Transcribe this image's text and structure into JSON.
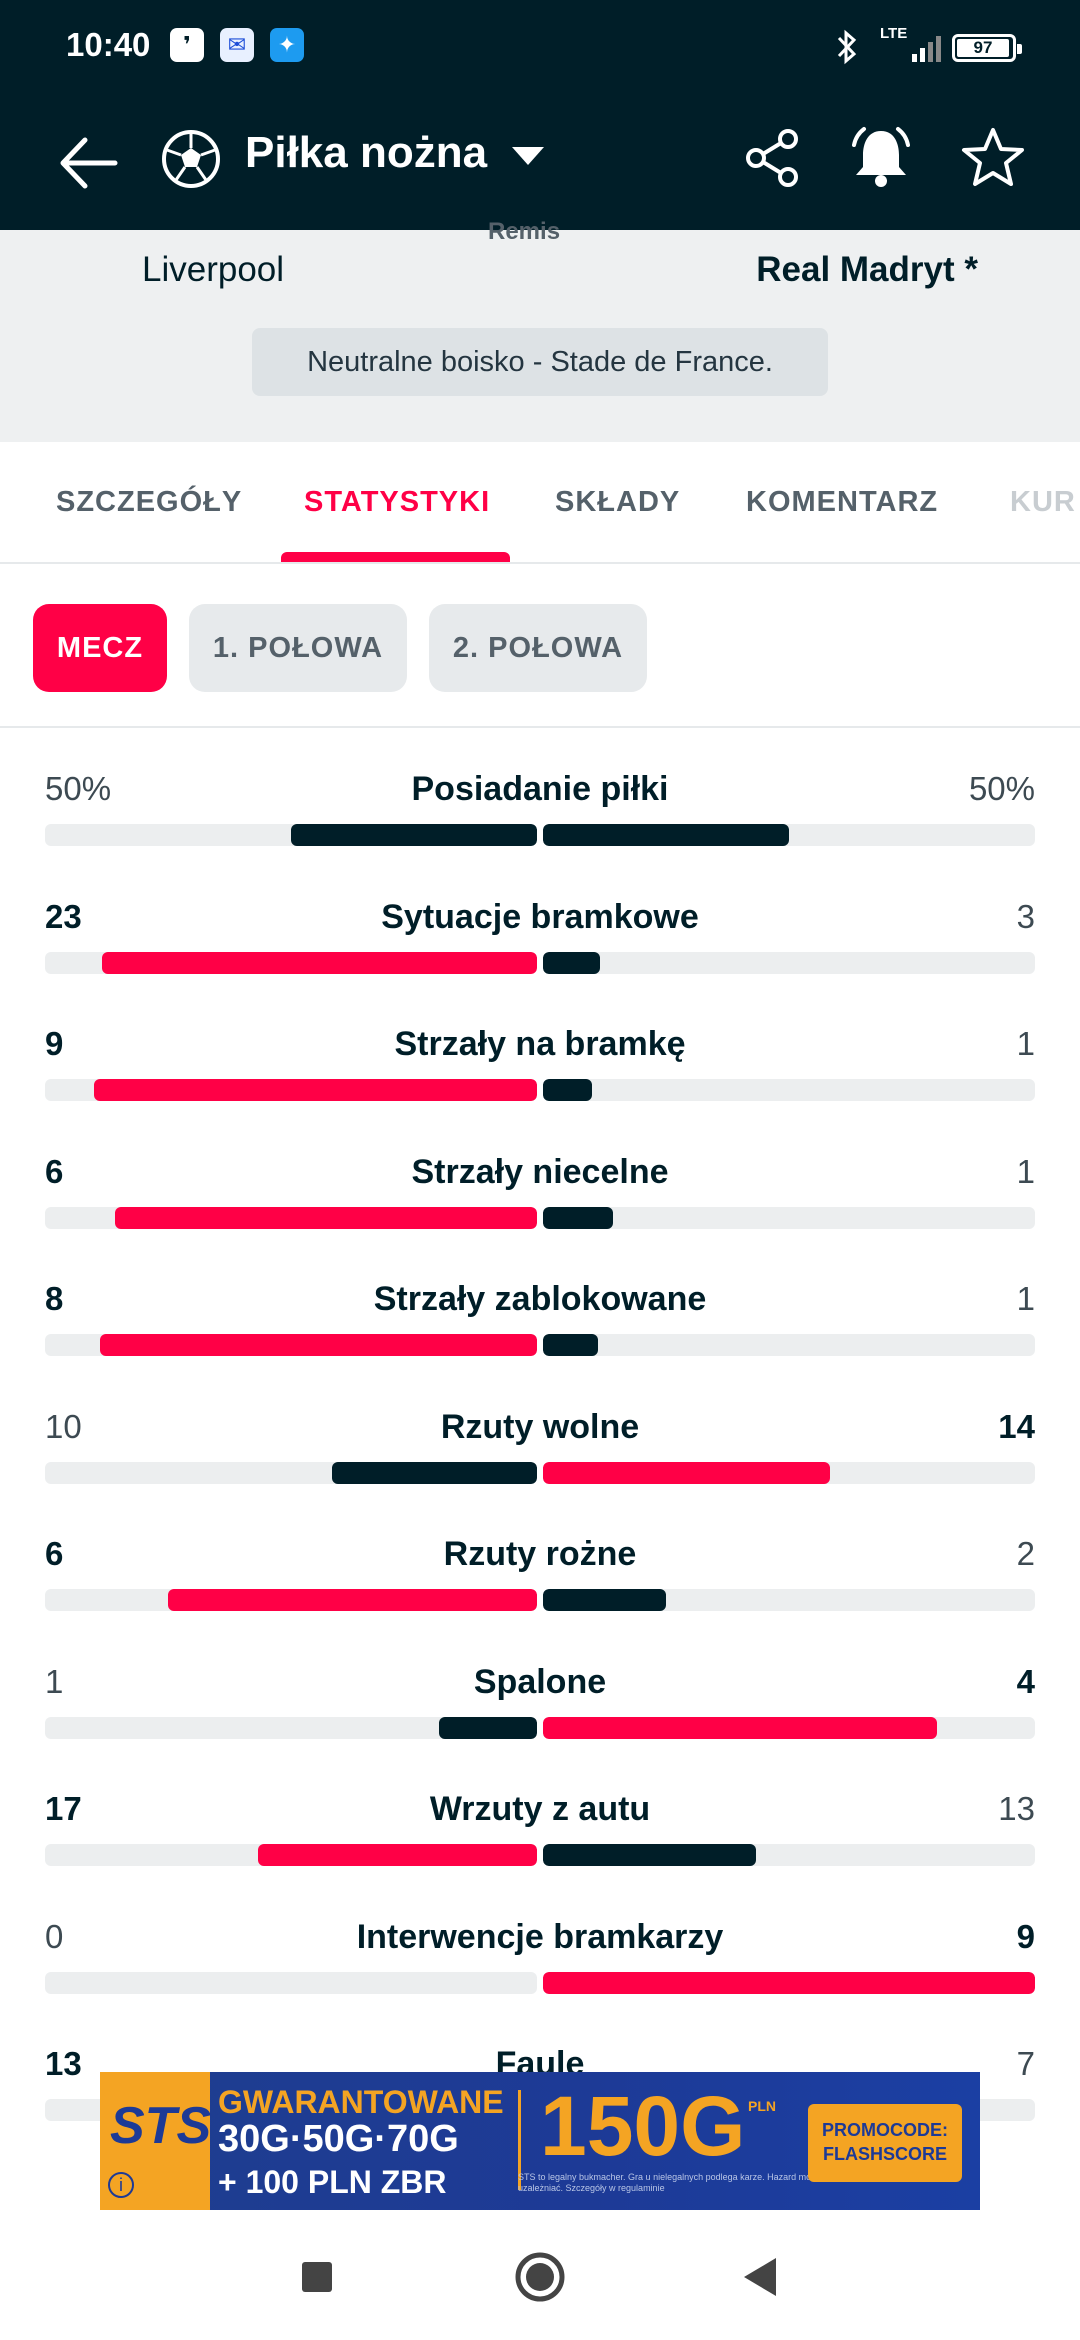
{
  "status_bar": {
    "time": "10:40",
    "network": "LTE",
    "battery": "97"
  },
  "nav": {
    "sport_title": "Piłka nożna"
  },
  "match": {
    "cut_text": "Remis",
    "home_team": "Liverpool",
    "away_team": "Real Madryt *",
    "venue": "Neutralne boisko - Stade de France."
  },
  "tabs": [
    {
      "label": "SZCZEGÓŁY"
    },
    {
      "label": "STATYSTYKI"
    },
    {
      "label": "SKŁADY"
    },
    {
      "label": "KOMENTARZ"
    },
    {
      "label": "KUR"
    }
  ],
  "periods": [
    {
      "label": "MECZ"
    },
    {
      "label": "1. POŁOWA"
    },
    {
      "label": "2. POŁOWA"
    }
  ],
  "colors": {
    "brand": "#ff0046",
    "dark": "#001e28",
    "track": "#eceeef"
  },
  "stats": [
    {
      "label": "Posiadanie piłki",
      "home": "50%",
      "away": "50%",
      "home_frac": 0.5,
      "away_frac": 0.5,
      "leader": "tie"
    },
    {
      "label": "Sytuacje bramkowe",
      "home": "23",
      "away": "3",
      "home_frac": 0.885,
      "away_frac": 0.115,
      "leader": "home"
    },
    {
      "label": "Strzały na bramkę",
      "home": "9",
      "away": "1",
      "home_frac": 0.9,
      "away_frac": 0.1,
      "leader": "home"
    },
    {
      "label": "Strzały niecelne",
      "home": "6",
      "away": "1",
      "home_frac": 0.857,
      "away_frac": 0.143,
      "leader": "home"
    },
    {
      "label": "Strzały zablokowane",
      "home": "8",
      "away": "1",
      "home_frac": 0.889,
      "away_frac": 0.111,
      "leader": "home"
    },
    {
      "label": "Rzuty wolne",
      "home": "10",
      "away": "14",
      "home_frac": 0.417,
      "away_frac": 0.583,
      "leader": "away"
    },
    {
      "label": "Rzuty rożne",
      "home": "6",
      "away": "2",
      "home_frac": 0.75,
      "away_frac": 0.25,
      "leader": "home"
    },
    {
      "label": "Spalone",
      "home": "1",
      "away": "4",
      "home_frac": 0.2,
      "away_frac": 0.8,
      "leader": "away"
    },
    {
      "label": "Wrzuty z autu",
      "home": "17",
      "away": "13",
      "home_frac": 0.567,
      "away_frac": 0.433,
      "leader": "home"
    },
    {
      "label": "Interwencje bramkarzy",
      "home": "0",
      "away": "9",
      "home_frac": 0.0,
      "away_frac": 1.0,
      "leader": "away"
    },
    {
      "label": "Faule",
      "home": "13",
      "away": "7",
      "home_frac": 0.65,
      "away_frac": 0.35,
      "leader": "home"
    }
  ],
  "ad": {
    "logo": "STS",
    "info_glyph": "i",
    "guaranteed": "GWARANTOWANE",
    "amounts": "30G·50G·70G",
    "bonus": "+ 100 PLN ZBR",
    "big": "150G",
    "currency": "PLN",
    "small": "STS to legalny bukmacher. Gra u nielegalnych podlega karze. Hazard może uzależniać. Szczegóły w regulaminie",
    "promo_line1": "PROMOCODE:",
    "promo_line2": "FLASHSCORE"
  }
}
